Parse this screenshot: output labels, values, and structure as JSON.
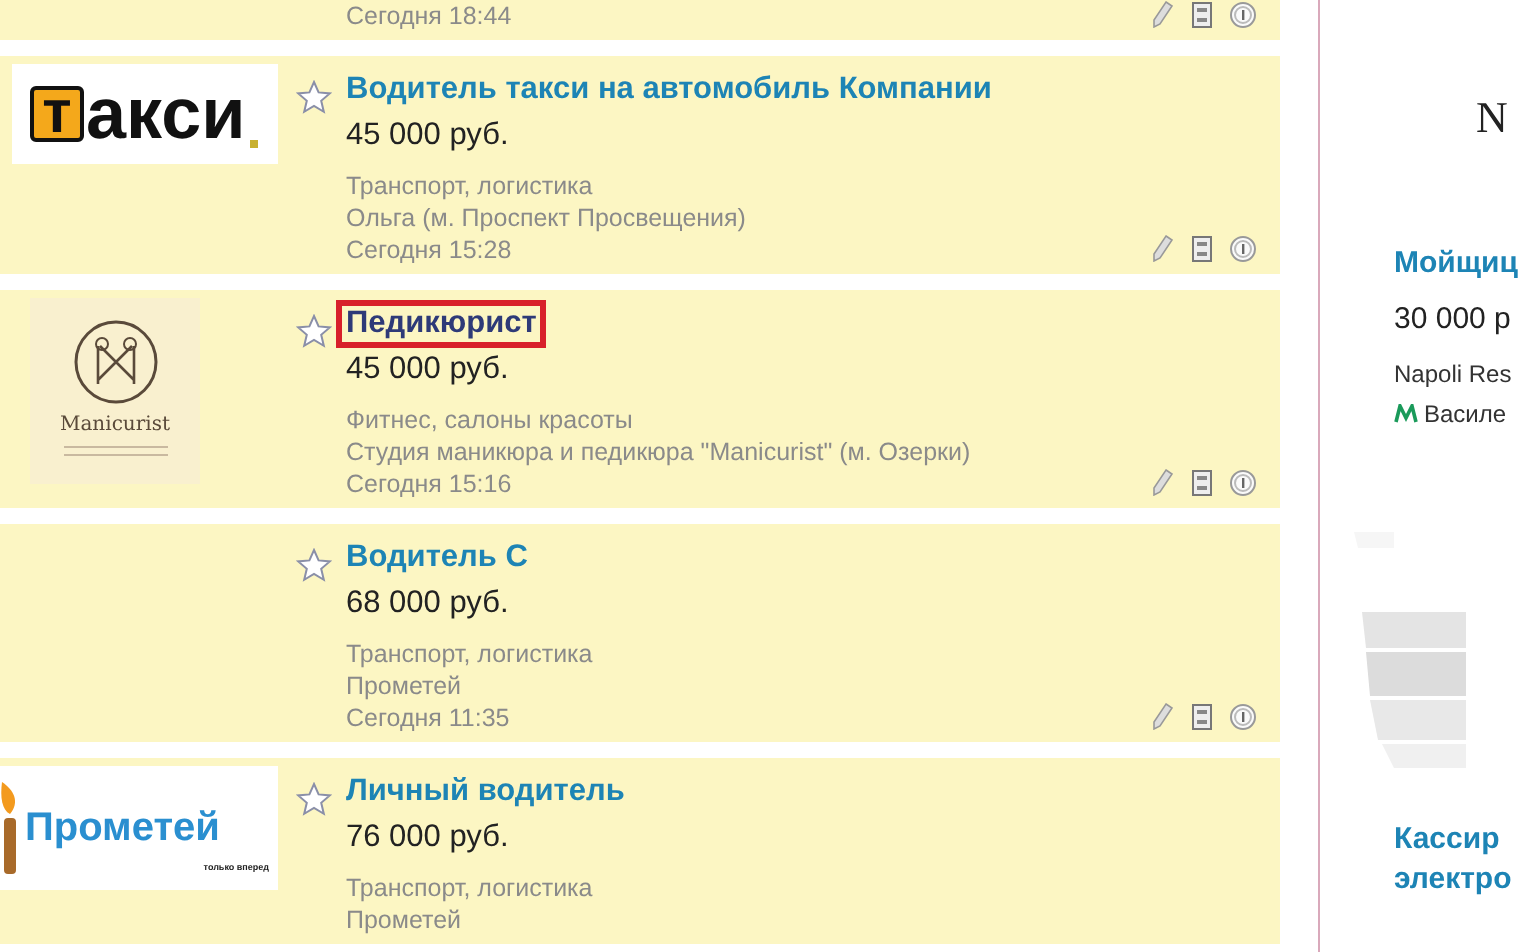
{
  "listings": [
    {
      "date": "Сегодня 18:44"
    },
    {
      "logo": {
        "kind": "taxi",
        "letter": "т",
        "rest": "акси"
      },
      "title": "Водитель такси на автомобиль Компании",
      "highlighted": false,
      "salary": "45 000 руб.",
      "category": "Транспорт, логистика",
      "employer": "Ольга (м. Проспект Просвещения)",
      "date": "Сегодня 15:28"
    },
    {
      "logo": {
        "kind": "manicurist",
        "name": "Manicurist"
      },
      "title": "Педикюрист",
      "highlighted": true,
      "salary": "45 000 руб.",
      "category": "Фитнес, салоны красоты",
      "employer": "Студия маникюра и педикюра \"Manicurist\" (м. Озерки)",
      "date": "Сегодня 15:16"
    },
    {
      "title": "Водитель С",
      "highlighted": false,
      "salary": "68 000 руб.",
      "category": "Транспорт, логистика",
      "employer": "Прометей",
      "date": "Сегодня 11:35"
    },
    {
      "logo": {
        "kind": "prometey",
        "name": "Прометей",
        "tagline": "только вперед"
      },
      "title": "Личный водитель",
      "highlighted": false,
      "salary": "76 000 руб.",
      "category": "Транспорт, логистика",
      "employer": "Прометей"
    }
  ],
  "sidebar": {
    "logo_letter": "N",
    "jobs": [
      {
        "title": "Мойщиц",
        "salary": "30 000 р",
        "employer": "Napoli Res",
        "metro": "Василе"
      },
      {
        "title": "Кассир",
        "title_line2": "электро"
      }
    ]
  }
}
